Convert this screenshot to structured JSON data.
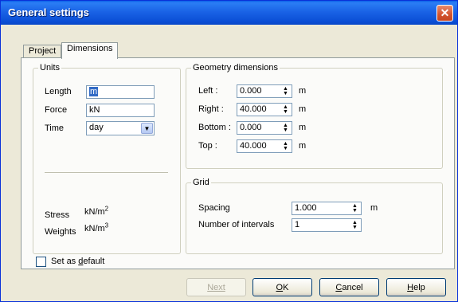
{
  "window": {
    "title": "General settings",
    "close_icon": "close-icon"
  },
  "tabs": [
    {
      "label": "Project",
      "active": false
    },
    {
      "label": "Dimensions",
      "active": true
    }
  ],
  "units": {
    "legend": "Units",
    "length_label": "Length",
    "length_value": "m",
    "force_label": "Force",
    "force_value": "kN",
    "time_label": "Time",
    "time_value": "day",
    "stress_label": "Stress",
    "stress_unit_base": "kN/m",
    "stress_unit_exp": "2",
    "weights_label": "Weights",
    "weights_unit_base": "kN/m",
    "weights_unit_exp": "3"
  },
  "geometry": {
    "legend": "Geometry dimensions",
    "left_label": "Left :",
    "left_value": "0.000",
    "left_unit": "m",
    "right_label": "Right :",
    "right_value": "40.000",
    "right_unit": "m",
    "bottom_label": "Bottom :",
    "bottom_value": "0.000",
    "bottom_unit": "m",
    "top_label": "Top :",
    "top_value": "40.000",
    "top_unit": "m"
  },
  "grid": {
    "legend": "Grid",
    "spacing_label": "Spacing",
    "spacing_value": "1.000",
    "spacing_unit": "m",
    "intervals_label": "Number of intervals",
    "intervals_value": "1"
  },
  "default_checkbox": {
    "prefix": "Set as ",
    "underlined": "d",
    "suffix": "efault",
    "checked": false
  },
  "buttons": {
    "next_label": "Next",
    "ok_underlined": "O",
    "ok_rest": "K",
    "cancel_underlined": "C",
    "cancel_rest": "ancel",
    "help_underlined": "H",
    "help_rest": "elp"
  }
}
